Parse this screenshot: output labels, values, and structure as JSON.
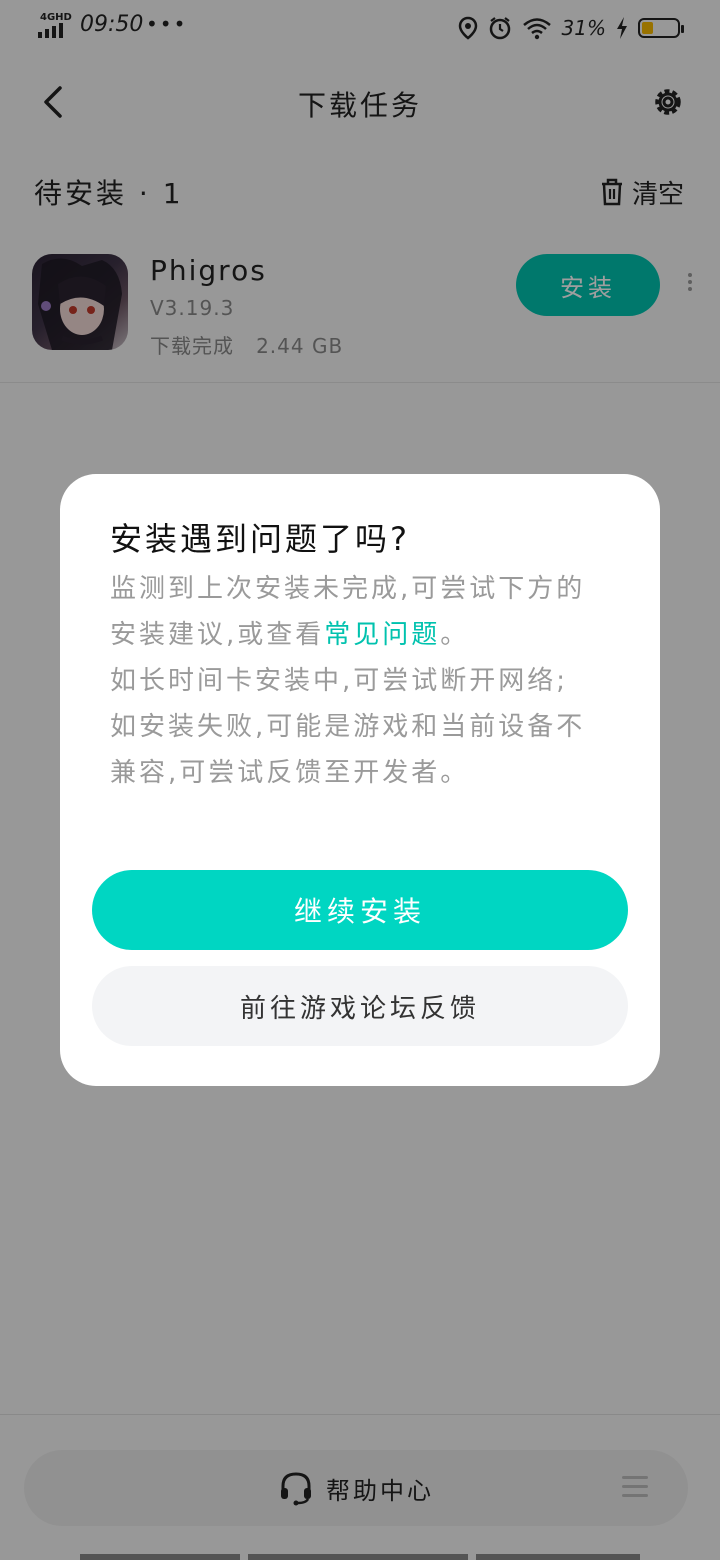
{
  "status_bar": {
    "network": "4GHD",
    "time": "09:50",
    "dots": "•••",
    "battery_percent": "31%",
    "battery_level": 0.31,
    "battery_color": "#f5b800",
    "icons": [
      "location-icon",
      "alarm-icon",
      "wifi-icon",
      "charging-icon"
    ]
  },
  "header": {
    "title": "下载任务",
    "back_icon": "chevron-left-icon",
    "settings_icon": "gear-icon"
  },
  "section": {
    "label": "待安装 · 1",
    "clear_label": "清空",
    "clear_icon": "trash-icon"
  },
  "tasks": [
    {
      "name": "Phigros",
      "version": "V3.19.3",
      "status": "下载完成",
      "size": "2.44 GB",
      "action": "安装"
    }
  ],
  "dialog": {
    "title": "安装遇到问题了吗?",
    "line1_before": "监测到上次安装未完成,可尝试下方的安装建议,或查看",
    "line1_link": "常见问题",
    "line1_after": "。",
    "line2": "如长时间卡安装中,可尝试断开网络;",
    "line3": "如安装失败,可能是游戏和当前设备不兼容,可尝试反馈至开发者。",
    "primary_button": "继续安装",
    "secondary_button": "前往游戏论坛反馈"
  },
  "bottom": {
    "help_label": "帮助中心",
    "help_icon": "headset-icon",
    "menu_icon": "menu-icon"
  },
  "colors": {
    "accent": "#00c2ae",
    "primary_button": "#00d6c2",
    "overlay": "rgba(0,0,0,0.38)"
  }
}
